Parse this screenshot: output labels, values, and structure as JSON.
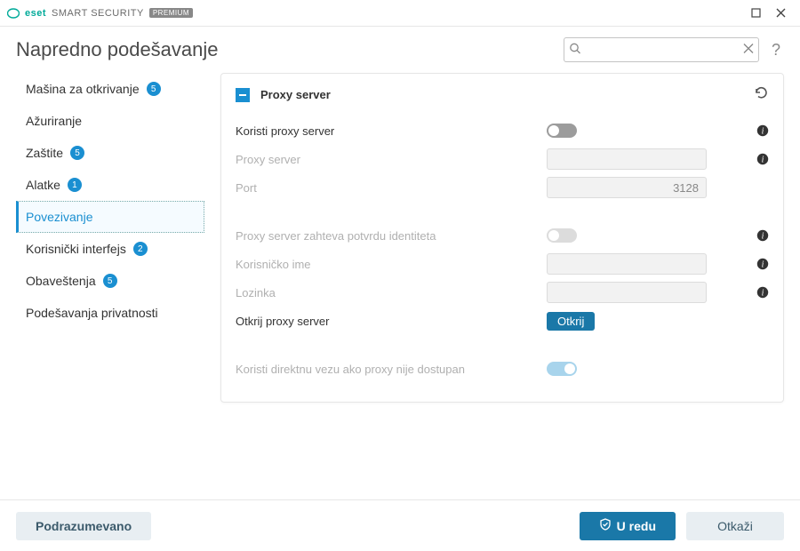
{
  "titlebar": {
    "brand_eset": "eset",
    "brand_product": "SMART SECURITY",
    "brand_tier": "PREMIUM"
  },
  "header": {
    "title": "Napredno podešavanje",
    "search_placeholder": "",
    "help": "?"
  },
  "sidebar": {
    "items": [
      {
        "label": "Mašina za otkrivanje",
        "badge": "5"
      },
      {
        "label": "Ažuriranje",
        "badge": ""
      },
      {
        "label": "Zaštite",
        "badge": "5"
      },
      {
        "label": "Alatke",
        "badge": "1"
      },
      {
        "label": "Povezivanje",
        "badge": "",
        "selected": true
      },
      {
        "label": "Korisnički interfejs",
        "badge": "2"
      },
      {
        "label": "Obaveštenja",
        "badge": "5"
      },
      {
        "label": "Podešavanja privatnosti",
        "badge": ""
      }
    ]
  },
  "panel": {
    "title": "Proxy server",
    "rows": {
      "use_proxy": {
        "label": "Koristi proxy server",
        "value": false
      },
      "proxy_server": {
        "label": "Proxy server",
        "value": ""
      },
      "port": {
        "label": "Port",
        "value": "3128"
      },
      "auth": {
        "label": "Proxy server zahteva potvrdu identiteta",
        "value": false
      },
      "username": {
        "label": "Korisničko ime",
        "value": ""
      },
      "password": {
        "label": "Lozinka",
        "value": ""
      },
      "detect": {
        "label": "Otkrij proxy server",
        "button": "Otkrij"
      },
      "direct": {
        "label": "Koristi direktnu vezu ako proxy nije dostupan",
        "value": true
      }
    }
  },
  "footer": {
    "default": "Podrazumevano",
    "ok": "U redu",
    "cancel": "Otkaži"
  }
}
